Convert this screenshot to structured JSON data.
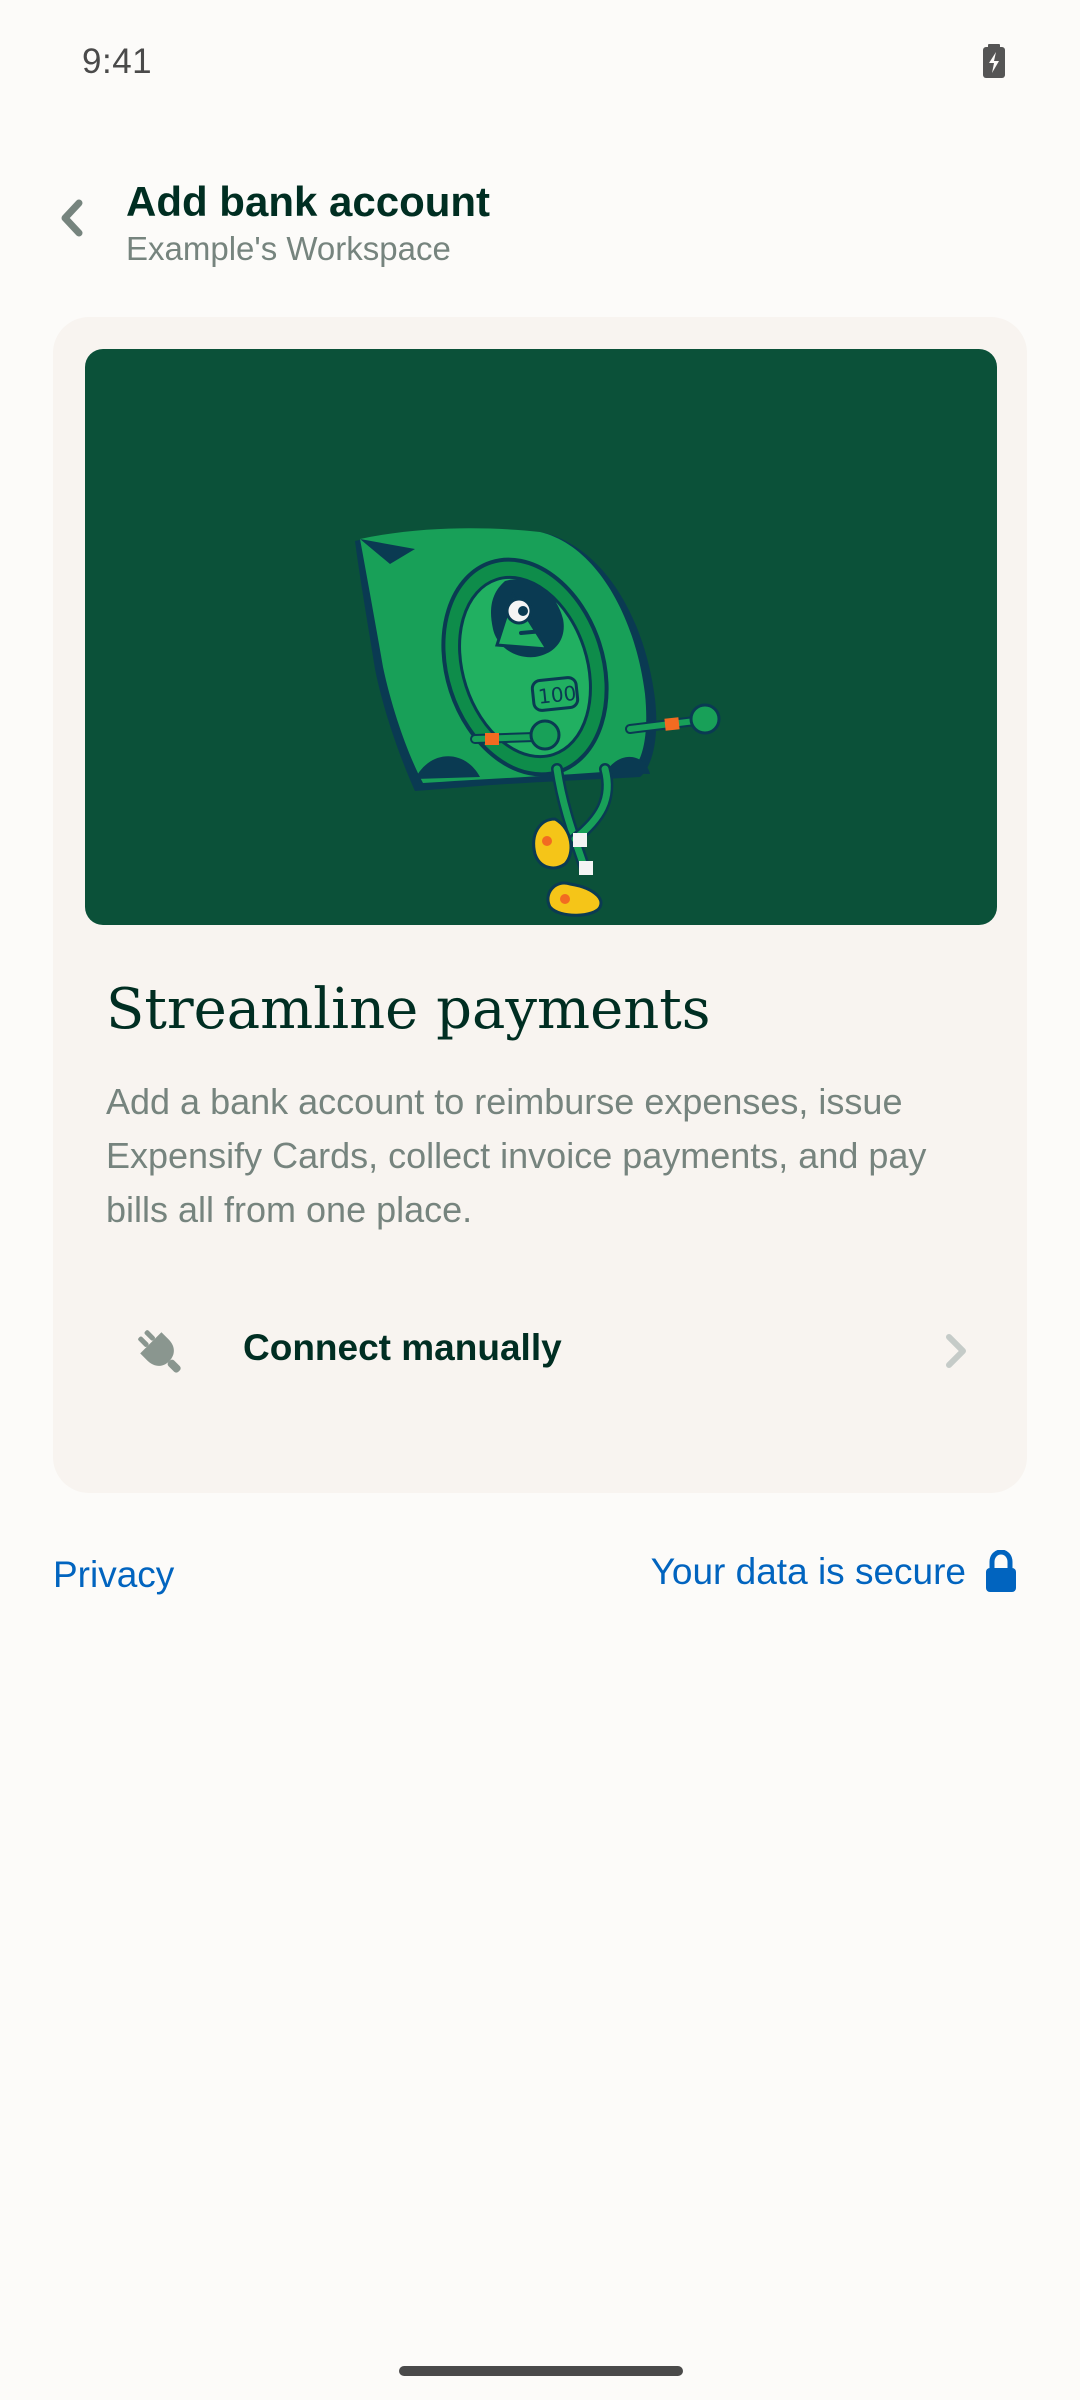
{
  "status_bar": {
    "time": "9:41",
    "battery_icon": "battery-charging-icon"
  },
  "header": {
    "title": "Add bank account",
    "subtitle": "Example's Workspace",
    "back_icon": "chevron-left-icon"
  },
  "card": {
    "illustration": "money-bill-character-illustration",
    "heading": "Streamline payments",
    "body": "Add a bank account to reimburse expenses, issue Expensify Cards, collect invoice payments, and pay bills all from one place.",
    "connect_option": {
      "icon": "plug-icon",
      "label": "Connect manually",
      "trailing_icon": "chevron-right-icon"
    }
  },
  "footer": {
    "privacy_label": "Privacy",
    "secure_label": "Your data is secure",
    "secure_icon": "lock-icon"
  },
  "colors": {
    "background": "#FCFBF9",
    "card": "#F8F4F0",
    "hero": "#0B5139",
    "text_primary": "#002E22",
    "text_secondary": "#76847E",
    "link": "#0164BF"
  }
}
